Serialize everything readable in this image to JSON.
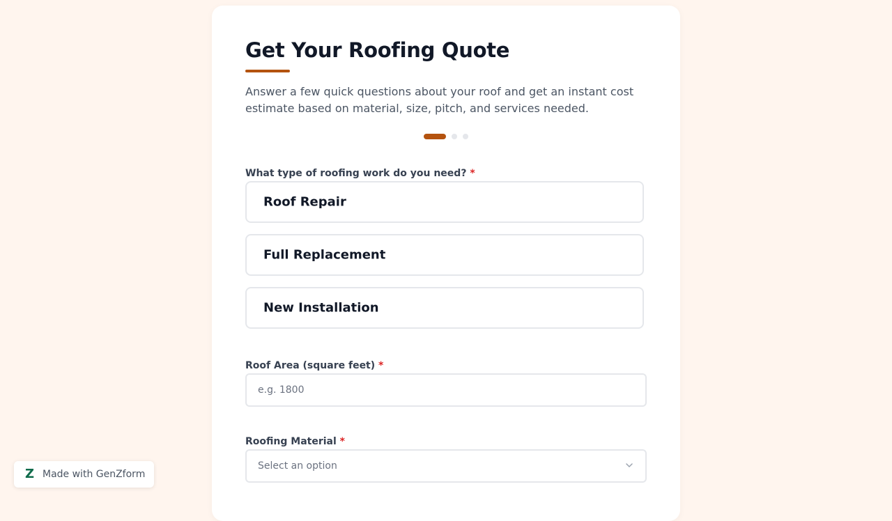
{
  "form": {
    "title": "Get Your Roofing Quote",
    "subtitle": "Answer a few quick questions about your roof and get an instant cost estimate based on material, size, pitch, and services needed.",
    "progress": {
      "current_step": 1,
      "total_steps": 3
    },
    "accent_color": "#b4530f",
    "required_marker": "*"
  },
  "question_work_type": {
    "label": "What type of roofing work do you need?",
    "options": [
      "Roof Repair",
      "Full Replacement",
      "New Installation"
    ]
  },
  "question_area": {
    "label": "Roof Area (square feet)",
    "placeholder": "e.g. 1800",
    "value": ""
  },
  "question_material": {
    "label": "Roofing Material",
    "selected": "Select an option",
    "icon": "chevron-down-icon"
  },
  "badge": {
    "logo": "Z",
    "text": "Made with GenZform"
  }
}
